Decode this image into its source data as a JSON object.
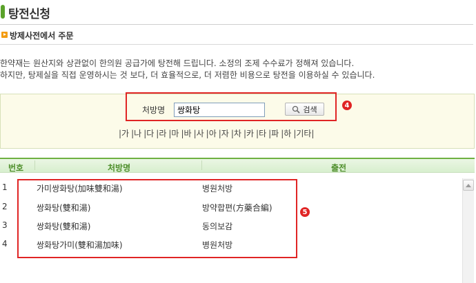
{
  "page": {
    "title": "탕전신청",
    "section_title": "방제사전에서 주문",
    "intro_lines": [
      "한약재는 원산지와 상관없이 한의원 공급가에 탕전해 드립니다. 소정의 조제 수수료가 정해져 있습니다.",
      "하지만, 탕제실을 직접 운영하시는 것 보다, 더 효율적으로, 더 저렴한 비용으로 탕전을 이용하실 수 있습니다."
    ]
  },
  "search": {
    "label": "처방명",
    "value": "쌍화탕",
    "button_label": "검색",
    "marker": "4"
  },
  "index_letters": [
    "|가",
    "|나",
    "|다",
    "|라",
    "|마",
    "|바",
    "|사",
    "|아",
    "|자",
    "|차",
    "|카",
    "|타",
    "|파",
    "|하",
    "|기타|"
  ],
  "table": {
    "headers": {
      "num": "번호",
      "name": "처방명",
      "source": "출전"
    },
    "rows": [
      {
        "num": "1",
        "name": "가미쌍화탕(加味雙和湯)",
        "source": "병원처방"
      },
      {
        "num": "2",
        "name": "쌍화탕(雙和湯)",
        "source": "방약합편(方藥合編)"
      },
      {
        "num": "3",
        "name": "쌍화탕(雙和湯)",
        "source": "동의보감"
      },
      {
        "num": "4",
        "name": "쌍화탕가미(雙和湯加味)",
        "source": "병원처방"
      }
    ],
    "marker": "5"
  },
  "colors": {
    "accent_green": "#6db041",
    "highlight_red": "#e02424",
    "panel_bg": "#fcfbe9"
  },
  "icons": {
    "search_button": "magnifier-icon",
    "title": "green-bar-icon",
    "section": "orange-arrow-icon",
    "scroll": "scroll-up-arrow-icon"
  }
}
